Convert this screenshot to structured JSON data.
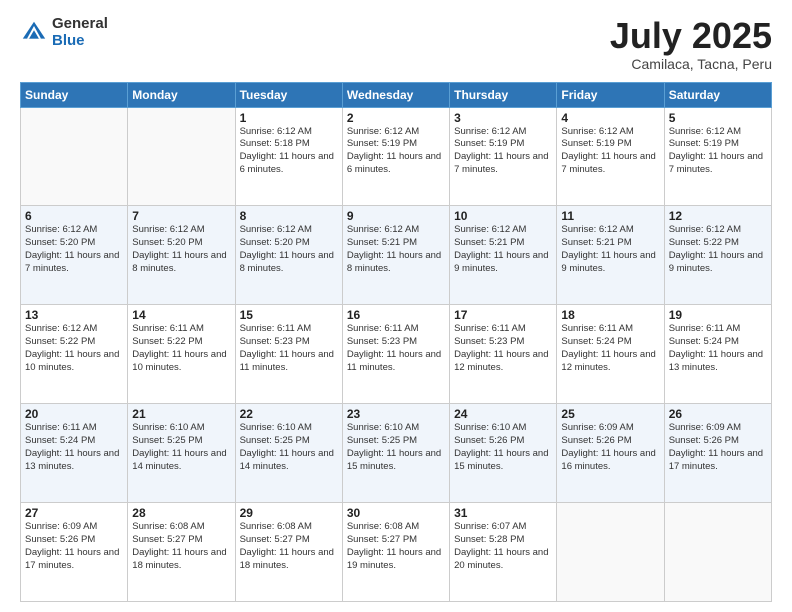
{
  "header": {
    "logo_general": "General",
    "logo_blue": "Blue",
    "title": "July 2025",
    "subtitle": "Camilaca, Tacna, Peru"
  },
  "days_of_week": [
    "Sunday",
    "Monday",
    "Tuesday",
    "Wednesday",
    "Thursday",
    "Friday",
    "Saturday"
  ],
  "weeks": [
    [
      {
        "day": "",
        "info": ""
      },
      {
        "day": "",
        "info": ""
      },
      {
        "day": "1",
        "info": "Sunrise: 6:12 AM\nSunset: 5:18 PM\nDaylight: 11 hours and 6 minutes."
      },
      {
        "day": "2",
        "info": "Sunrise: 6:12 AM\nSunset: 5:19 PM\nDaylight: 11 hours and 6 minutes."
      },
      {
        "day": "3",
        "info": "Sunrise: 6:12 AM\nSunset: 5:19 PM\nDaylight: 11 hours and 7 minutes."
      },
      {
        "day": "4",
        "info": "Sunrise: 6:12 AM\nSunset: 5:19 PM\nDaylight: 11 hours and 7 minutes."
      },
      {
        "day": "5",
        "info": "Sunrise: 6:12 AM\nSunset: 5:19 PM\nDaylight: 11 hours and 7 minutes."
      }
    ],
    [
      {
        "day": "6",
        "info": "Sunrise: 6:12 AM\nSunset: 5:20 PM\nDaylight: 11 hours and 7 minutes."
      },
      {
        "day": "7",
        "info": "Sunrise: 6:12 AM\nSunset: 5:20 PM\nDaylight: 11 hours and 8 minutes."
      },
      {
        "day": "8",
        "info": "Sunrise: 6:12 AM\nSunset: 5:20 PM\nDaylight: 11 hours and 8 minutes."
      },
      {
        "day": "9",
        "info": "Sunrise: 6:12 AM\nSunset: 5:21 PM\nDaylight: 11 hours and 8 minutes."
      },
      {
        "day": "10",
        "info": "Sunrise: 6:12 AM\nSunset: 5:21 PM\nDaylight: 11 hours and 9 minutes."
      },
      {
        "day": "11",
        "info": "Sunrise: 6:12 AM\nSunset: 5:21 PM\nDaylight: 11 hours and 9 minutes."
      },
      {
        "day": "12",
        "info": "Sunrise: 6:12 AM\nSunset: 5:22 PM\nDaylight: 11 hours and 9 minutes."
      }
    ],
    [
      {
        "day": "13",
        "info": "Sunrise: 6:12 AM\nSunset: 5:22 PM\nDaylight: 11 hours and 10 minutes."
      },
      {
        "day": "14",
        "info": "Sunrise: 6:11 AM\nSunset: 5:22 PM\nDaylight: 11 hours and 10 minutes."
      },
      {
        "day": "15",
        "info": "Sunrise: 6:11 AM\nSunset: 5:23 PM\nDaylight: 11 hours and 11 minutes."
      },
      {
        "day": "16",
        "info": "Sunrise: 6:11 AM\nSunset: 5:23 PM\nDaylight: 11 hours and 11 minutes."
      },
      {
        "day": "17",
        "info": "Sunrise: 6:11 AM\nSunset: 5:23 PM\nDaylight: 11 hours and 12 minutes."
      },
      {
        "day": "18",
        "info": "Sunrise: 6:11 AM\nSunset: 5:24 PM\nDaylight: 11 hours and 12 minutes."
      },
      {
        "day": "19",
        "info": "Sunrise: 6:11 AM\nSunset: 5:24 PM\nDaylight: 11 hours and 13 minutes."
      }
    ],
    [
      {
        "day": "20",
        "info": "Sunrise: 6:11 AM\nSunset: 5:24 PM\nDaylight: 11 hours and 13 minutes."
      },
      {
        "day": "21",
        "info": "Sunrise: 6:10 AM\nSunset: 5:25 PM\nDaylight: 11 hours and 14 minutes."
      },
      {
        "day": "22",
        "info": "Sunrise: 6:10 AM\nSunset: 5:25 PM\nDaylight: 11 hours and 14 minutes."
      },
      {
        "day": "23",
        "info": "Sunrise: 6:10 AM\nSunset: 5:25 PM\nDaylight: 11 hours and 15 minutes."
      },
      {
        "day": "24",
        "info": "Sunrise: 6:10 AM\nSunset: 5:26 PM\nDaylight: 11 hours and 15 minutes."
      },
      {
        "day": "25",
        "info": "Sunrise: 6:09 AM\nSunset: 5:26 PM\nDaylight: 11 hours and 16 minutes."
      },
      {
        "day": "26",
        "info": "Sunrise: 6:09 AM\nSunset: 5:26 PM\nDaylight: 11 hours and 17 minutes."
      }
    ],
    [
      {
        "day": "27",
        "info": "Sunrise: 6:09 AM\nSunset: 5:26 PM\nDaylight: 11 hours and 17 minutes."
      },
      {
        "day": "28",
        "info": "Sunrise: 6:08 AM\nSunset: 5:27 PM\nDaylight: 11 hours and 18 minutes."
      },
      {
        "day": "29",
        "info": "Sunrise: 6:08 AM\nSunset: 5:27 PM\nDaylight: 11 hours and 18 minutes."
      },
      {
        "day": "30",
        "info": "Sunrise: 6:08 AM\nSunset: 5:27 PM\nDaylight: 11 hours and 19 minutes."
      },
      {
        "day": "31",
        "info": "Sunrise: 6:07 AM\nSunset: 5:28 PM\nDaylight: 11 hours and 20 minutes."
      },
      {
        "day": "",
        "info": ""
      },
      {
        "day": "",
        "info": ""
      }
    ]
  ]
}
